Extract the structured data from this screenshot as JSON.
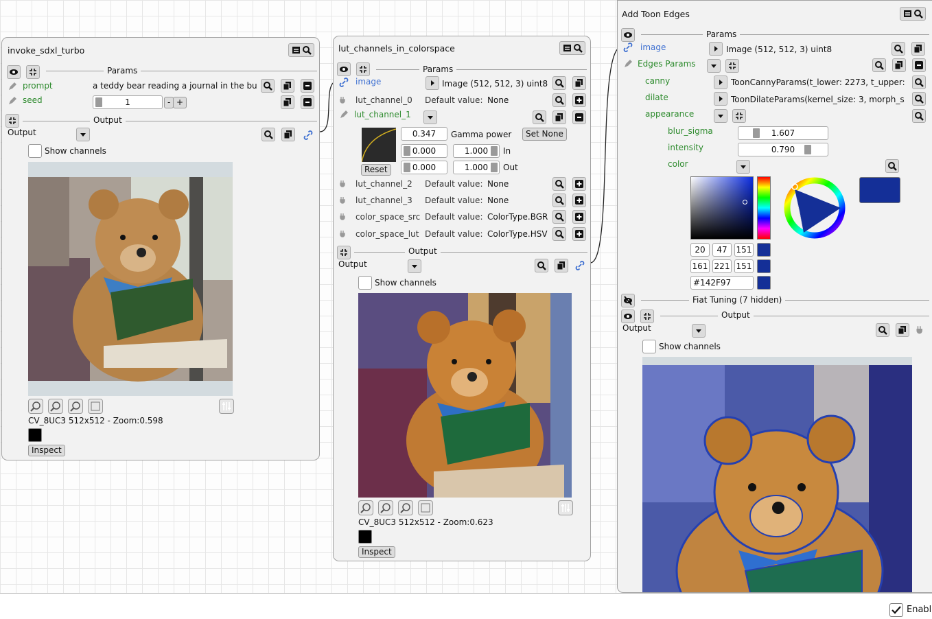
{
  "nodes": {
    "sdxl": {
      "title": "invoke_sdxl_turbo",
      "params_label": "Params",
      "prompt_label": "prompt",
      "prompt_value": "a teddy bear reading a journal in the bu...",
      "seed_label": "seed",
      "seed_value": "1",
      "minus": "-",
      "plus": "+",
      "output_section": "Output",
      "output_label": "Output",
      "show_channels": "Show channels",
      "image_info": "CV_8UC3 512x512 - Zoom:0.598",
      "inspect": "Inspect"
    },
    "lut": {
      "title": "lut_channels_in_colorspace",
      "params_label": "Params",
      "image_label": "image",
      "image_value": "Image (512, 512, 3) uint8",
      "ch0_label": "lut_channel_0",
      "ch0_default_label": "Default value:",
      "ch0_default": "None",
      "ch1_label": "lut_channel_1",
      "gamma_value": "0.347",
      "gamma_label": "Gamma power",
      "set_none": "Set None",
      "in_min": "0.000",
      "in_max": "1.000",
      "in_label": "In",
      "out_min": "0.000",
      "out_max": "1.000",
      "out_label": "Out",
      "reset": "Reset",
      "ch2_label": "lut_channel_2",
      "ch2_default_label": "Default value:",
      "ch2_default": "None",
      "ch3_label": "lut_channel_3",
      "ch3_default_label": "Default value:",
      "ch3_default": "None",
      "cs_src_label": "color_space_src",
      "cs_src_default_label": "Default value:",
      "cs_src_default": "ColorType.BGR",
      "cs_lut_label": "color_space_lut",
      "cs_lut_default_label": "Default value:",
      "cs_lut_default": "ColorType.HSV",
      "output_section": "Output",
      "output_label": "Output",
      "show_channels": "Show channels",
      "image_info": "CV_8UC3 512x512 - Zoom:0.623",
      "inspect": "Inspect"
    },
    "toon": {
      "title": "Add Toon Edges",
      "params_label": "Params",
      "image_label": "image",
      "image_value": "Image (512, 512, 3) uint8",
      "edges_label": "Edges Params",
      "canny_label": "canny",
      "canny_value": "ToonCannyParams(t_lower: 2273, t_upper: ...",
      "dilate_label": "dilate",
      "dilate_value": "ToonDilateParams(kernel_size: 3, morph_s...",
      "appearance_label": "appearance",
      "blur_label": "blur_sigma",
      "blur_value": "1.607",
      "blur_fraction": 0.05,
      "intensity_label": "intensity",
      "intensity_value": "0.790",
      "intensity_fraction": 0.79,
      "color_label": "color",
      "rgb": [
        "20",
        "47",
        "151"
      ],
      "hsv": [
        "161",
        "221",
        "151"
      ],
      "hex": "#142F97",
      "color_hex": "#142F97",
      "fiat_label": "Fiat Tuning (7 hidden)",
      "output_section": "Output",
      "output_label": "Output",
      "show_channels": "Show channels"
    }
  },
  "footer": {
    "enable_label": "Enable",
    "enable_checked": true
  }
}
